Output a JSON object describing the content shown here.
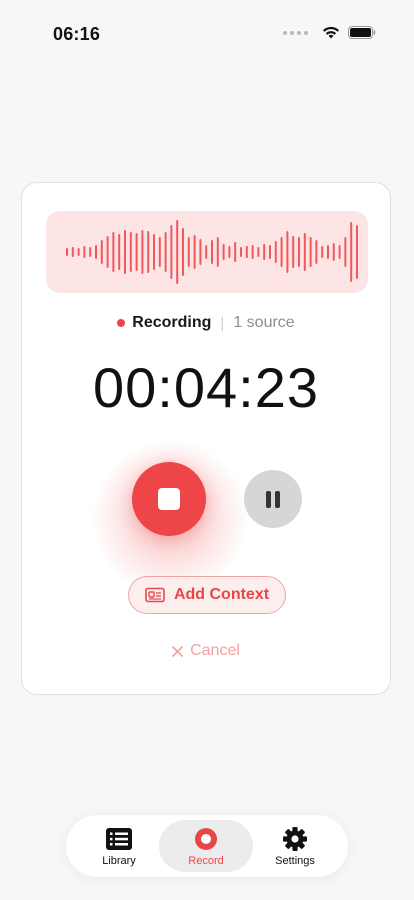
{
  "status_bar": {
    "time": "06:16"
  },
  "recording": {
    "status_label": "Recording",
    "source_count": "1 source",
    "elapsed": "00:04:23"
  },
  "actions": {
    "add_context_label": "Add Context",
    "cancel_label": "Cancel"
  },
  "tabs": [
    {
      "label": "Library",
      "icon": "library-icon"
    },
    {
      "label": "Record",
      "icon": "record-icon",
      "selected": true
    },
    {
      "label": "Settings",
      "icon": "gear-icon"
    }
  ],
  "colors": {
    "accent": "#ed4548",
    "waveform_bg": "#fde5e5",
    "waveform_bar": "#f0585b"
  }
}
